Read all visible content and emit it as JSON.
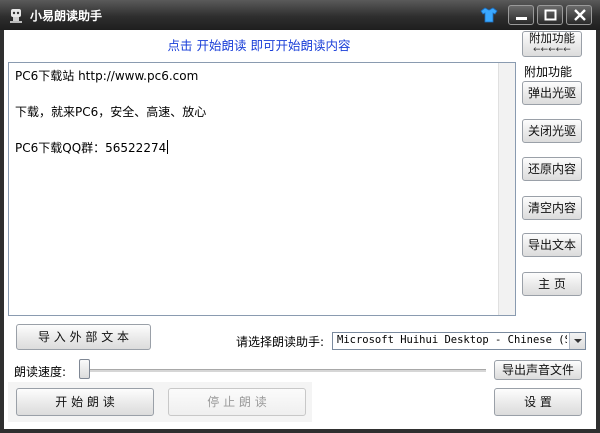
{
  "window": {
    "title": "小易朗读助手"
  },
  "hint": "点击 开始朗读 即可开始朗读内容",
  "editor": {
    "lines": [
      "PC6下载站 http://www.pc6.com",
      "",
      "下载，就来PC6，安全、高速、放心",
      "",
      "PC6下载QQ群：56522274"
    ]
  },
  "addon": {
    "toggle_label": "附加功能",
    "toggle_arrows": "←←←←←",
    "section_title": "附加功能",
    "buttons": [
      "弹出光驱",
      "关闭光驱",
      "还原内容",
      "清空内容",
      "导出文本",
      "主  页"
    ]
  },
  "import_button": "导 入 外 部 文 本",
  "voice": {
    "label": "请选择朗读助手:",
    "selected": "Microsoft Huihui Desktop - Chinese (Simplified)"
  },
  "speed": {
    "label": "朗读速度:",
    "value": 0
  },
  "export_audio_button": "导出声音文件",
  "start_button": "开 始 朗 读",
  "stop_button": "停 止 朗 读",
  "settings_button": "设  置",
  "colors": {
    "hint_text": "#1a3fd8",
    "titlebar": "#2e2e2e"
  }
}
